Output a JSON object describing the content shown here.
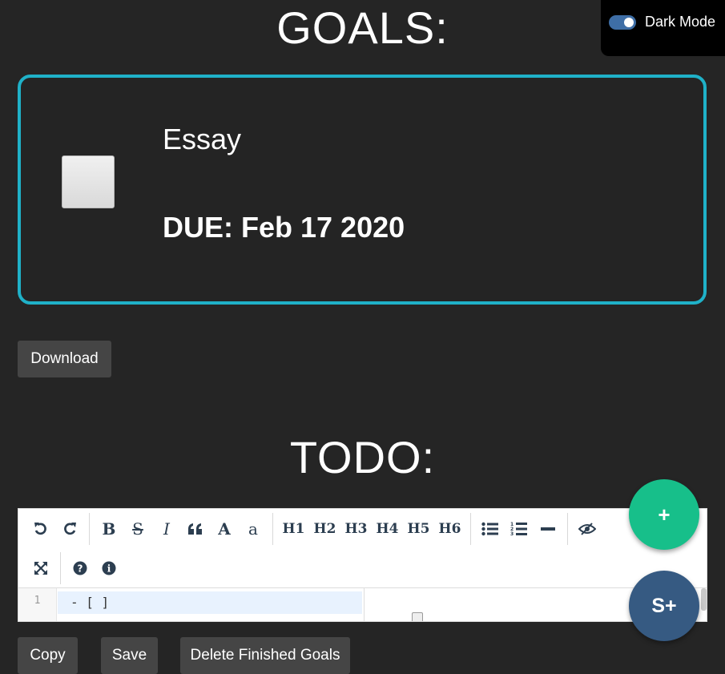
{
  "goals": {
    "title": "GOALS:",
    "items": [
      {
        "name": "Essay",
        "due": "DUE: Feb 17 2020",
        "checked": false,
        "border_color": "#1fb1c8"
      }
    ],
    "download_label": "Download"
  },
  "dark_mode": {
    "label": "Dark Mode",
    "enabled": true,
    "toggle_color": "#3e6ea6"
  },
  "todo": {
    "title": "TODO:",
    "toolbar": {
      "row1": [
        "undo-icon",
        "redo-icon",
        "bold-icon",
        "strikethrough-icon",
        "italic-icon",
        "quote-icon",
        "heading-bigger-icon",
        "heading-smaller-icon",
        "H1",
        "H2",
        "H3",
        "H4",
        "H5",
        "H6",
        "unordered-list-icon",
        "ordered-list-icon",
        "horizontal-rule-icon",
        "preview-icon"
      ],
      "row2": [
        "fullscreen-icon",
        "help-icon",
        "info-icon"
      ],
      "glyphs": {
        "bold": "B",
        "strike": "S",
        "italic": "I",
        "bigger": "A",
        "smaller": "a"
      },
      "headings": [
        "H1",
        "H2",
        "H3",
        "H4",
        "H5",
        "H6"
      ]
    },
    "editor": {
      "line_number": "1",
      "line_text": "- [ ]"
    },
    "buttons": {
      "copy": "Copy",
      "save": "Save",
      "delete_finished": "Delete Finished Goals"
    }
  },
  "fabs": {
    "add": "+",
    "s_plus": "S+",
    "add_color": "#17bf8a",
    "s_plus_color": "#365a82"
  }
}
